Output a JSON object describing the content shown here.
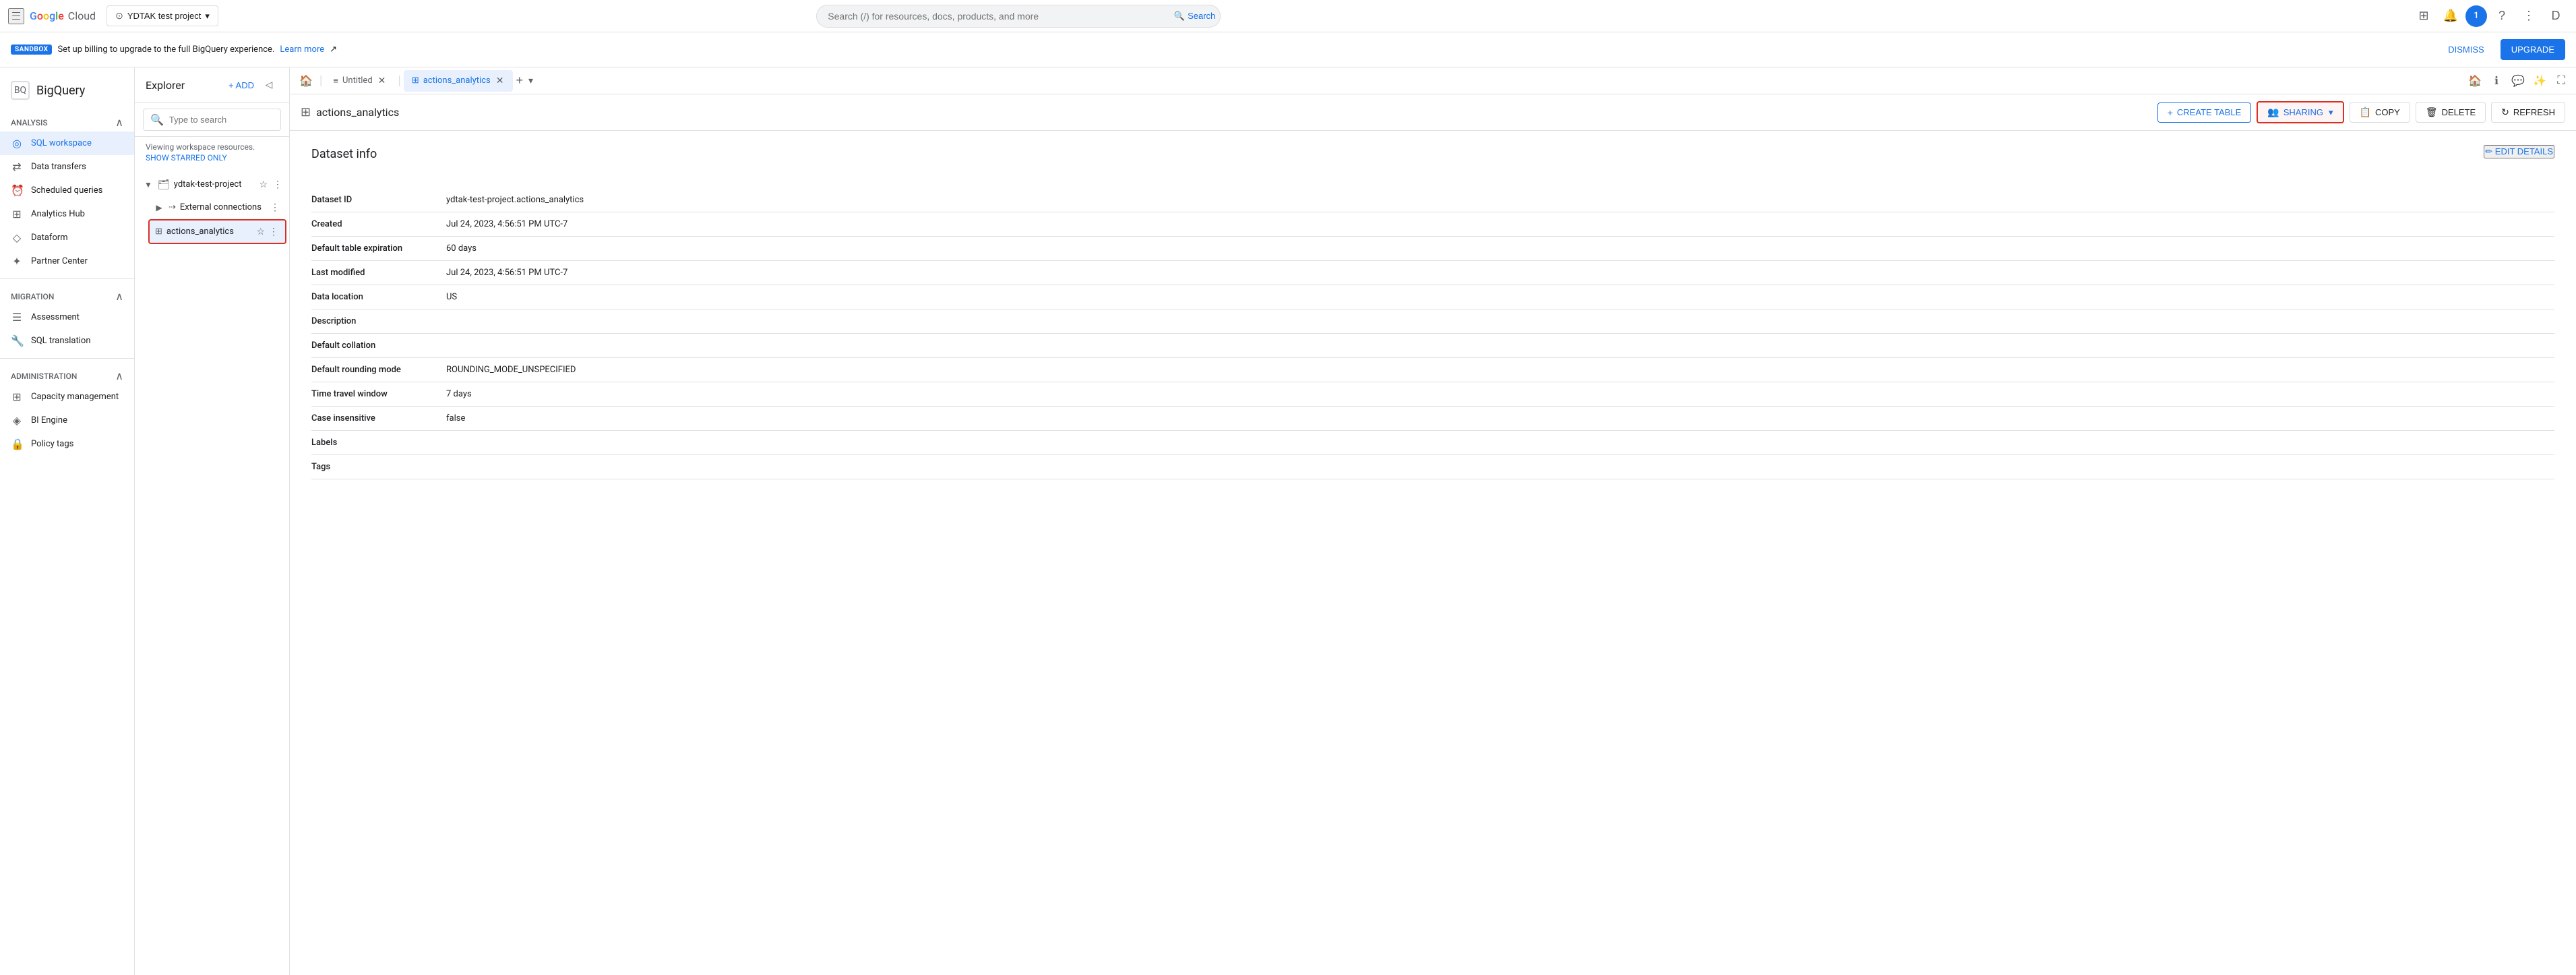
{
  "topbar": {
    "project_name": "YDTAK test project",
    "search_placeholder": "Search (/) for resources, docs, products, and more",
    "search_btn_label": "Search",
    "logo_google": "Google",
    "logo_cloud": "Cloud"
  },
  "sandbox": {
    "badge": "SANDBOX",
    "text": "Set up billing to upgrade to the full BigQuery experience.",
    "link_text": "Learn more",
    "dismiss_label": "DISMISS",
    "upgrade_label": "UPGRADE"
  },
  "sidebar": {
    "app_name": "BigQuery",
    "analysis_header": "Analysis",
    "items_analysis": [
      {
        "id": "sql-workspace",
        "label": "SQL workspace",
        "icon": "◎",
        "active": true
      },
      {
        "id": "data-transfers",
        "label": "Data transfers",
        "icon": "⇄"
      },
      {
        "id": "scheduled-queries",
        "label": "Scheduled queries",
        "icon": "⏰"
      },
      {
        "id": "analytics-hub",
        "label": "Analytics Hub",
        "icon": "⊞"
      },
      {
        "id": "dataform",
        "label": "Dataform",
        "icon": "◇"
      },
      {
        "id": "partner-center",
        "label": "Partner Center",
        "icon": "🤝"
      }
    ],
    "migration_header": "Migration",
    "items_migration": [
      {
        "id": "assessment",
        "label": "Assessment",
        "icon": "☰"
      },
      {
        "id": "sql-translation",
        "label": "SQL translation",
        "icon": "🔧"
      }
    ],
    "administration_header": "Administration",
    "items_administration": [
      {
        "id": "capacity-management",
        "label": "Capacity management",
        "icon": "⊞"
      },
      {
        "id": "bi-engine",
        "label": "BI Engine",
        "icon": "◈"
      },
      {
        "id": "policy-tags",
        "label": "Policy tags",
        "icon": "🔒"
      }
    ]
  },
  "explorer": {
    "title": "Explorer",
    "add_label": "+ ADD",
    "search_placeholder": "Type to search",
    "viewing_text": "Viewing workspace resources.",
    "show_starred_label": "SHOW STARRED ONLY",
    "project_name": "ydtak-test-project",
    "tree_items": [
      {
        "id": "external-connections",
        "label": "External connections",
        "type": "connection",
        "expanded": false
      },
      {
        "id": "actions-analytics",
        "label": "actions_analytics",
        "type": "dataset",
        "selected": true
      }
    ]
  },
  "tabs": [
    {
      "id": "home",
      "label": "",
      "type": "home",
      "icon": "🏠"
    },
    {
      "id": "untitled",
      "label": "Untitled",
      "type": "query",
      "closeable": true
    },
    {
      "id": "actions-analytics",
      "label": "actions_analytics",
      "type": "dataset",
      "closeable": true,
      "active": true
    }
  ],
  "dataset": {
    "title": "actions_analytics",
    "toolbar_buttons": [
      {
        "id": "create-table",
        "label": "CREATE TABLE",
        "icon": "+"
      },
      {
        "id": "sharing",
        "label": "SHARING",
        "icon": "👥",
        "has_dropdown": true
      },
      {
        "id": "copy",
        "label": "COPY",
        "icon": "📋"
      },
      {
        "id": "delete",
        "label": "DELETE",
        "icon": "🗑"
      },
      {
        "id": "refresh",
        "label": "REFRESH",
        "icon": "↻"
      }
    ],
    "edit_details_label": "✏ EDIT DETAILS",
    "info_title": "Dataset info",
    "fields": [
      {
        "label": "Dataset ID",
        "value": "ydtak-test-project.actions_analytics"
      },
      {
        "label": "Created",
        "value": "Jul 24, 2023, 4:56:51 PM UTC-7"
      },
      {
        "label": "Default table expiration",
        "value": "60 days"
      },
      {
        "label": "Last modified",
        "value": "Jul 24, 2023, 4:56:51 PM UTC-7"
      },
      {
        "label": "Data location",
        "value": "US"
      },
      {
        "label": "Description",
        "value": ""
      },
      {
        "label": "Default collation",
        "value": ""
      },
      {
        "label": "Default rounding mode",
        "value": "ROUNDING_MODE_UNSPECIFIED"
      },
      {
        "label": "Time travel window",
        "value": "7 days"
      },
      {
        "label": "Case insensitive",
        "value": "false"
      },
      {
        "label": "Labels",
        "value": ""
      },
      {
        "label": "Tags",
        "value": ""
      }
    ]
  }
}
